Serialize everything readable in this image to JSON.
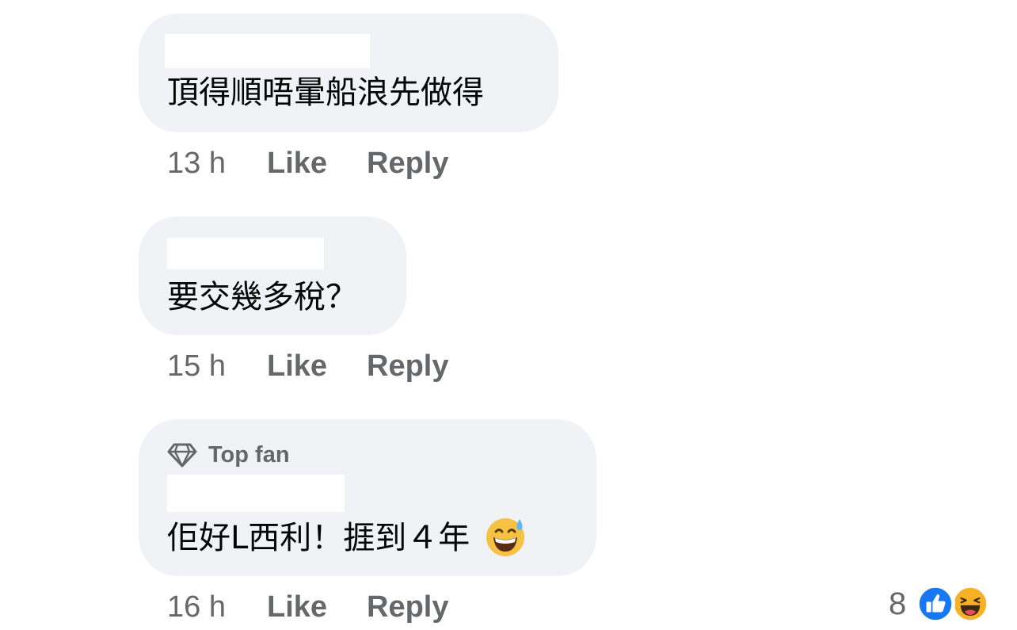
{
  "comments": [
    {
      "text": "頂得順唔暈船浪先做得",
      "time": "13 h",
      "like_label": "Like",
      "reply_label": "Reply"
    },
    {
      "text": "要交幾多稅？",
      "time": "15 h",
      "like_label": "Like",
      "reply_label": "Reply"
    },
    {
      "badge": "Top fan",
      "text": "佢好L西利！捱到４年",
      "emoji": "grinning-face-with-sweat",
      "time": "16 h",
      "like_label": "Like",
      "reply_label": "Reply"
    }
  ],
  "reactions": {
    "count": "8",
    "icons": [
      "like-icon",
      "haha-icon"
    ],
    "colors": {
      "like": "#1877f2",
      "haha": "#f7b125"
    }
  }
}
